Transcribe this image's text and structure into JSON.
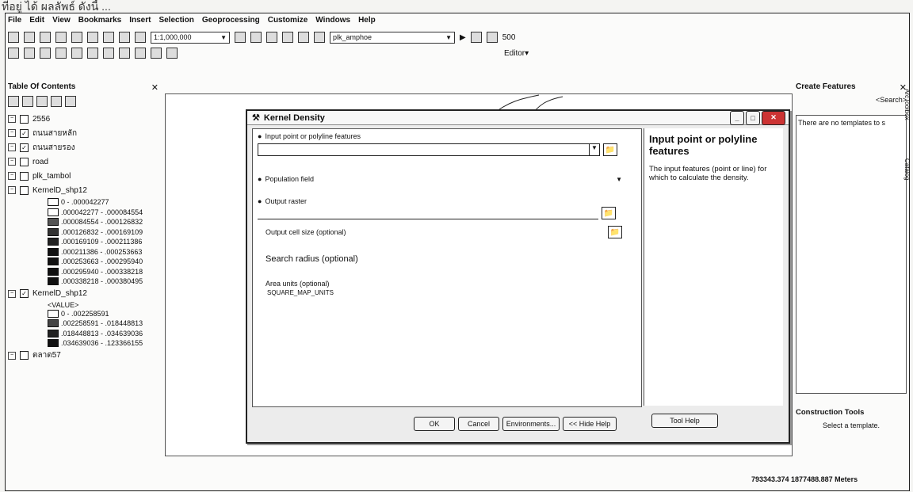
{
  "caption": "ที่อยู่ ได้ ผลลัพธ์ ดังนี้ ...",
  "menu": [
    "File",
    "Edit",
    "View",
    "Bookmarks",
    "Insert",
    "Selection",
    "Geoprocessing",
    "Customize",
    "Windows",
    "Help"
  ],
  "toolbar": {
    "scale": "1:1,000,000",
    "layer_combo": "plk_amphoe",
    "number_field": "500",
    "editor_label": "Editor▾"
  },
  "toc": {
    "title": "Table Of Contents",
    "layers": [
      {
        "name": "2556",
        "checked": false
      },
      {
        "name": "ถนนสายหลัก",
        "checked": true
      },
      {
        "name": "ถนนสายรอง",
        "checked": true
      },
      {
        "name": "road",
        "checked": false
      },
      {
        "name": "plk_tambol",
        "checked": false
      },
      {
        "name": "KernelD_shp12",
        "checked": false
      }
    ],
    "legend1": [
      {
        "label": "0 - .000042277",
        "color": "#ffffff"
      },
      {
        "label": ".000042277 - .000084554",
        "color": "#ffffff"
      },
      {
        "label": ".000084554 - .000126832",
        "color": "#555555"
      },
      {
        "label": ".000126832 - .000169109",
        "color": "#333333"
      },
      {
        "label": ".000169109 - .000211386",
        "color": "#222222"
      },
      {
        "label": ".000211386 - .000253663",
        "color": "#111111"
      },
      {
        "label": ".000253663 - .000295940",
        "color": "#111111"
      },
      {
        "label": ".000295940 - .000338218",
        "color": "#111111"
      },
      {
        "label": ".000338218 - .000380495",
        "color": "#111111"
      }
    ],
    "kernel2": {
      "name": "KernelD_shp12",
      "checked": true,
      "value_header": "<VALUE>"
    },
    "legend2": [
      {
        "label": "0 - .002258591",
        "color": "#ffffff"
      },
      {
        "label": ".002258591 - .018448813",
        "color": "#444444"
      },
      {
        "label": ".018448813 - .034639036",
        "color": "#222222"
      },
      {
        "label": ".034639036 - .123366155",
        "color": "#111111"
      }
    ],
    "last_layer": {
      "name": "ตลาด57",
      "checked": false
    }
  },
  "dialog": {
    "title": "Kernel Density",
    "fields": {
      "input_label": "Input point or polyline features",
      "population_label": "Population field",
      "output_label": "Output raster",
      "cellsize_label": "Output cell size (optional)",
      "radius_label": "Search radius (optional)",
      "area_label": "Area units (optional)",
      "area_value": "SQUARE_MAP_UNITS"
    },
    "help": {
      "heading": "Input point or polyline features",
      "text": "The input features (point or line) for which to calculate the density."
    },
    "buttons": {
      "ok": "OK",
      "cancel": "Cancel",
      "env": "Environments...",
      "hide": "<< Hide Help",
      "tool_help": "Tool Help"
    }
  },
  "right": {
    "create_title": "Create Features",
    "search_placeholder": "<Search>",
    "no_templates": "There are no templates to s",
    "construction_title": "Construction Tools",
    "select_template": "Select a template.",
    "side_tabs": [
      "ArcToolbox",
      "Catalog"
    ]
  },
  "status": {
    "coords": "793343.374  1877488.887 Meters"
  }
}
